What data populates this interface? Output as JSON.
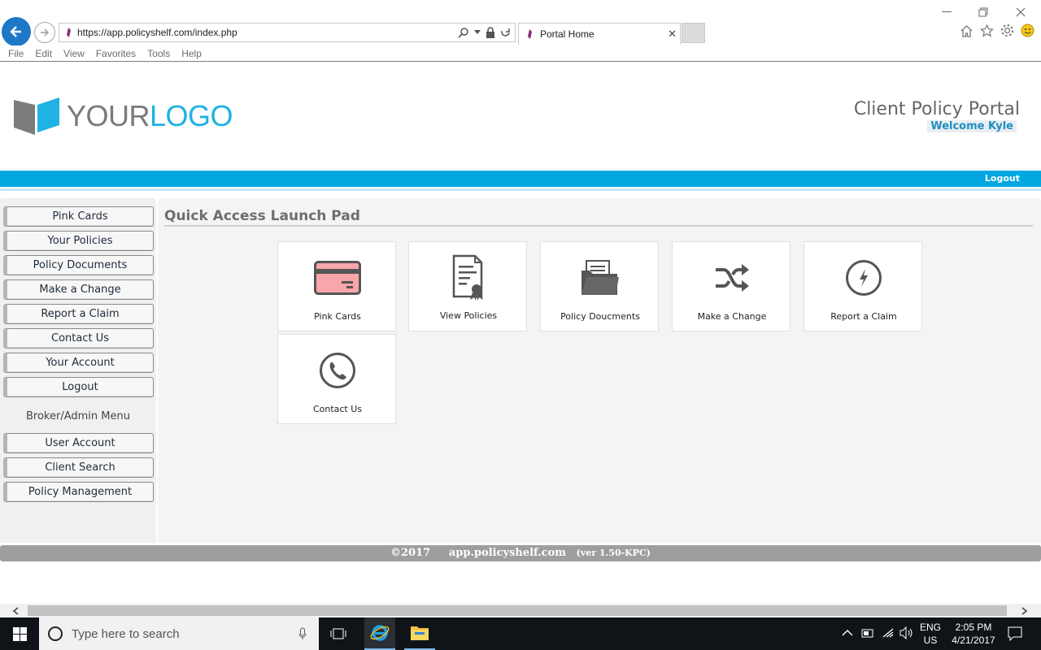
{
  "browser": {
    "url": "https://app.policyshelf.com/index.php",
    "tab_title": "Portal Home",
    "menu": [
      "File",
      "Edit",
      "View",
      "Favorites",
      "Tools",
      "Help"
    ]
  },
  "header": {
    "logo_word1": "YOUR",
    "logo_word2": "LOGO",
    "portal_title": "Client Policy Portal",
    "welcome": "Welcome Kyle",
    "logout": "Logout"
  },
  "sidebar": {
    "items": [
      "Pink Cards",
      "Your Policies",
      "Policy Documents",
      "Make a Change",
      "Report a Claim",
      "Contact Us",
      "Your Account",
      "Logout"
    ],
    "admin_heading": "Broker/Admin Menu",
    "admin_items": [
      "User Account",
      "Client Search",
      "Policy Management"
    ]
  },
  "main": {
    "title": "Quick Access Launch Pad",
    "tiles": [
      {
        "label": "Pink Cards",
        "icon": "credit-card-icon"
      },
      {
        "label": "View Policies",
        "icon": "certificate-document-icon"
      },
      {
        "label": "Policy Doucments",
        "icon": "folder-documents-icon"
      },
      {
        "label": "Make a Change",
        "icon": "shuffle-icon"
      },
      {
        "label": "Report a Claim",
        "icon": "lightning-circle-icon"
      },
      {
        "label": "Contact Us",
        "icon": "phone-circle-icon"
      }
    ]
  },
  "footer": {
    "copyright": "©2017",
    "domain": "app.policyshelf.com",
    "version": "(ver 1.50-KPC)"
  },
  "taskbar": {
    "search_placeholder": "Type here to search",
    "lang1": "ENG",
    "lang2": "US",
    "time": "2:05 PM",
    "date": "4/21/2017"
  },
  "colors": {
    "accent_blue": "#00a7e1",
    "logo_blue": "#1fb2e3",
    "card_pink": "#f7a6aa"
  }
}
